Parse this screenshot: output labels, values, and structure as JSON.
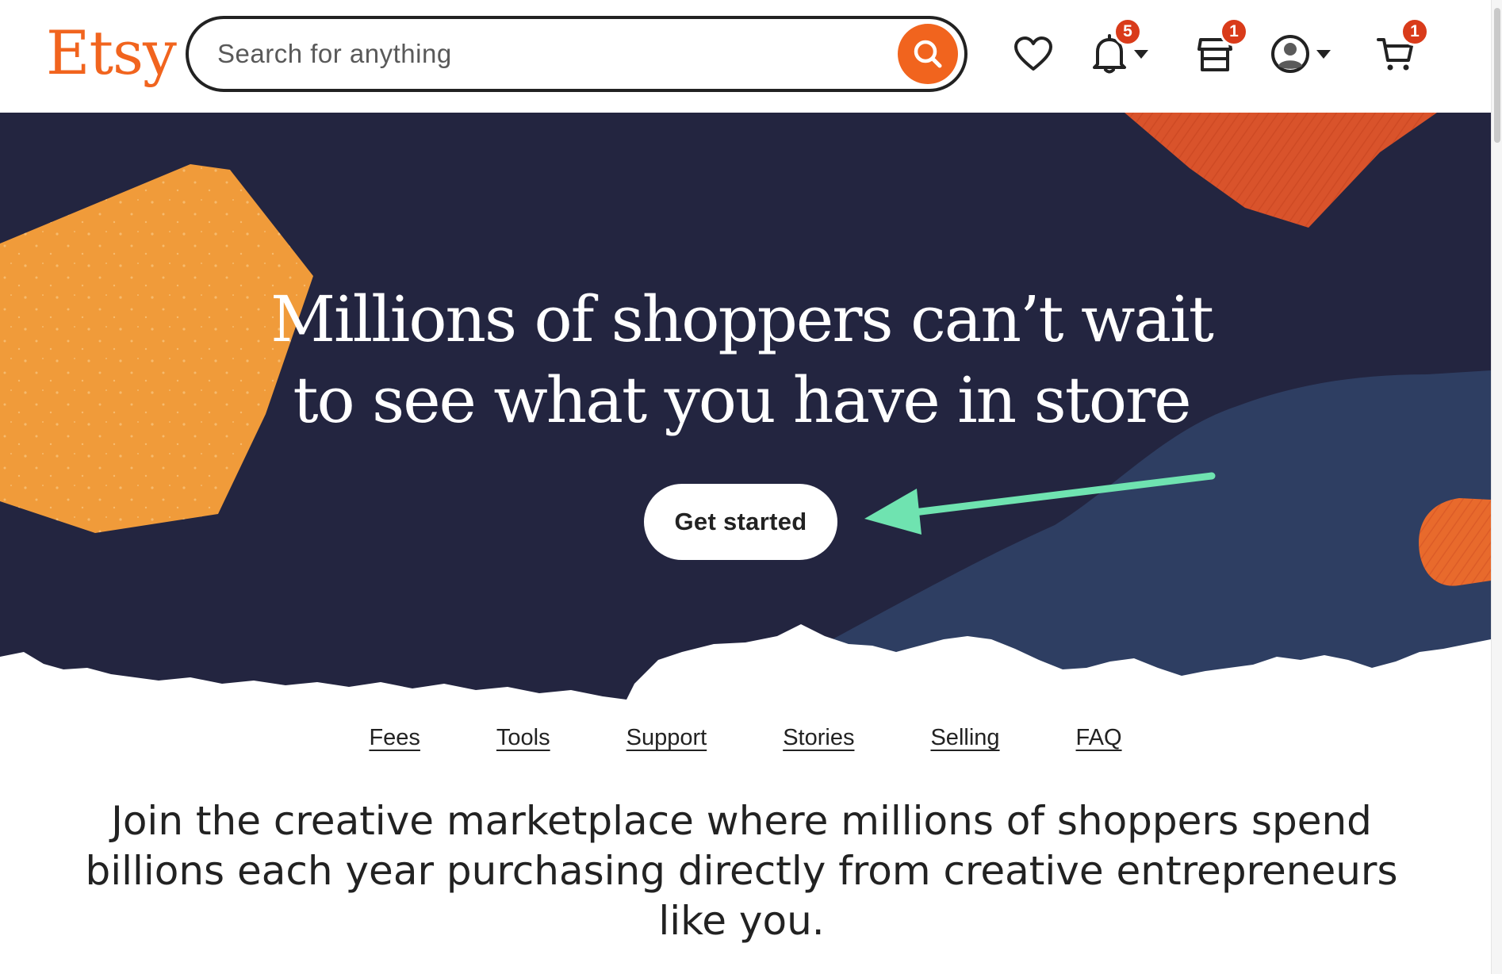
{
  "header": {
    "logo_text": "Etsy",
    "search_placeholder": "Search for anything",
    "icons": {
      "favorites": "heart-icon",
      "notifications": "bell-icon",
      "shop_manager": "shop-icon",
      "account": "user-avatar-icon",
      "cart": "cart-icon"
    },
    "notifications_badge": "5",
    "shop_badge": "1",
    "cart_badge": "1"
  },
  "hero": {
    "headline": "Millions of shoppers can’t wait to see what you have in store",
    "cta_label": "Get started"
  },
  "subnav": [
    "Fees",
    "Tools",
    "Support",
    "Stories",
    "Selling",
    "FAQ"
  ],
  "tagline": "Join the creative marketplace where millions of shoppers spend billions each year purchasing directly from creative entrepreneurs like you.",
  "colors": {
    "brand_orange": "#F1641E",
    "hero_navy": "#232540",
    "hero_blue": "#2E3E62",
    "shape_yellow": "#F09B3A",
    "annotation_green": "#6FE3B0"
  }
}
